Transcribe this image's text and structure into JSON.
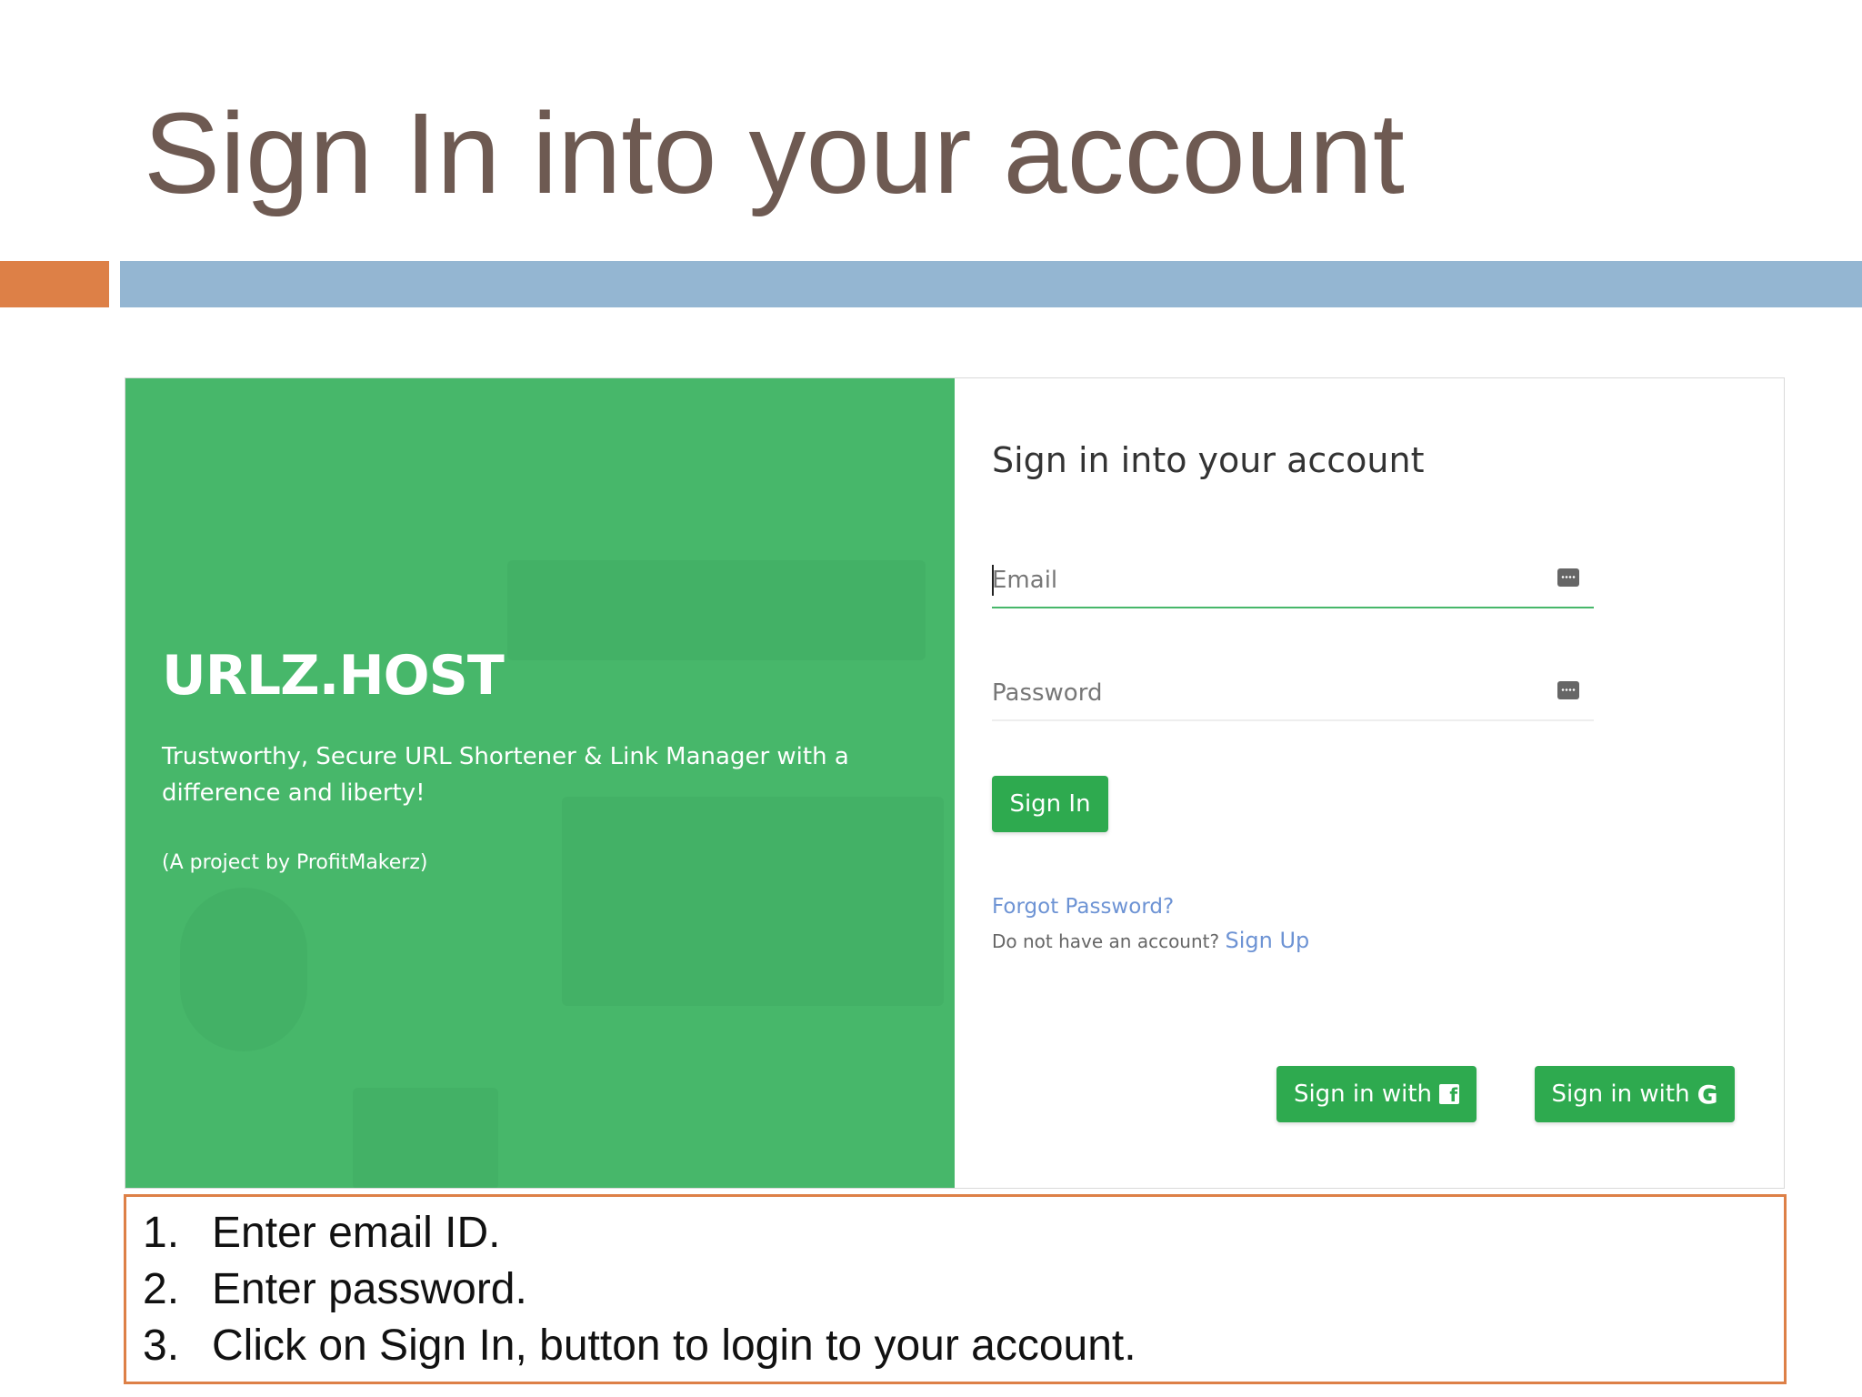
{
  "slide": {
    "title": "Sign In into your account",
    "accent_colors": {
      "orange": "#dd8047",
      "blue": "#94b6d2"
    }
  },
  "brand": {
    "name": "URLZ.HOST",
    "tagline": "Trustworthy, Secure URL Shortener & Link Manager with a difference and liberty!",
    "project": "(A project by ProfitMakerz)",
    "panel_color": "#47b76a"
  },
  "form": {
    "heading": "Sign in into your account",
    "email_placeholder": "Email",
    "password_placeholder": "Password",
    "email_icon": "key-dots-icon",
    "password_icon": "key-dots-icon",
    "signin_label": "Sign In",
    "forgot_label": "Forgot Password?",
    "no_account_text": "Do not have an account?",
    "signup_label": "Sign Up",
    "facebook_label": "Sign in with",
    "facebook_icon": "facebook-icon",
    "facebook_glyph": "f",
    "google_label": "Sign in with",
    "google_icon": "google-icon",
    "google_glyph": "G",
    "button_color": "#2eaa4f",
    "link_color": "#6d93d4"
  },
  "instructions": {
    "items": [
      {
        "num": "1.",
        "text": "Enter email ID."
      },
      {
        "num": "2.",
        "text": "Enter password."
      },
      {
        "num": "3.",
        "text": "Click on Sign In, button to login to your account."
      }
    ],
    "border_color": "#dd8047"
  }
}
